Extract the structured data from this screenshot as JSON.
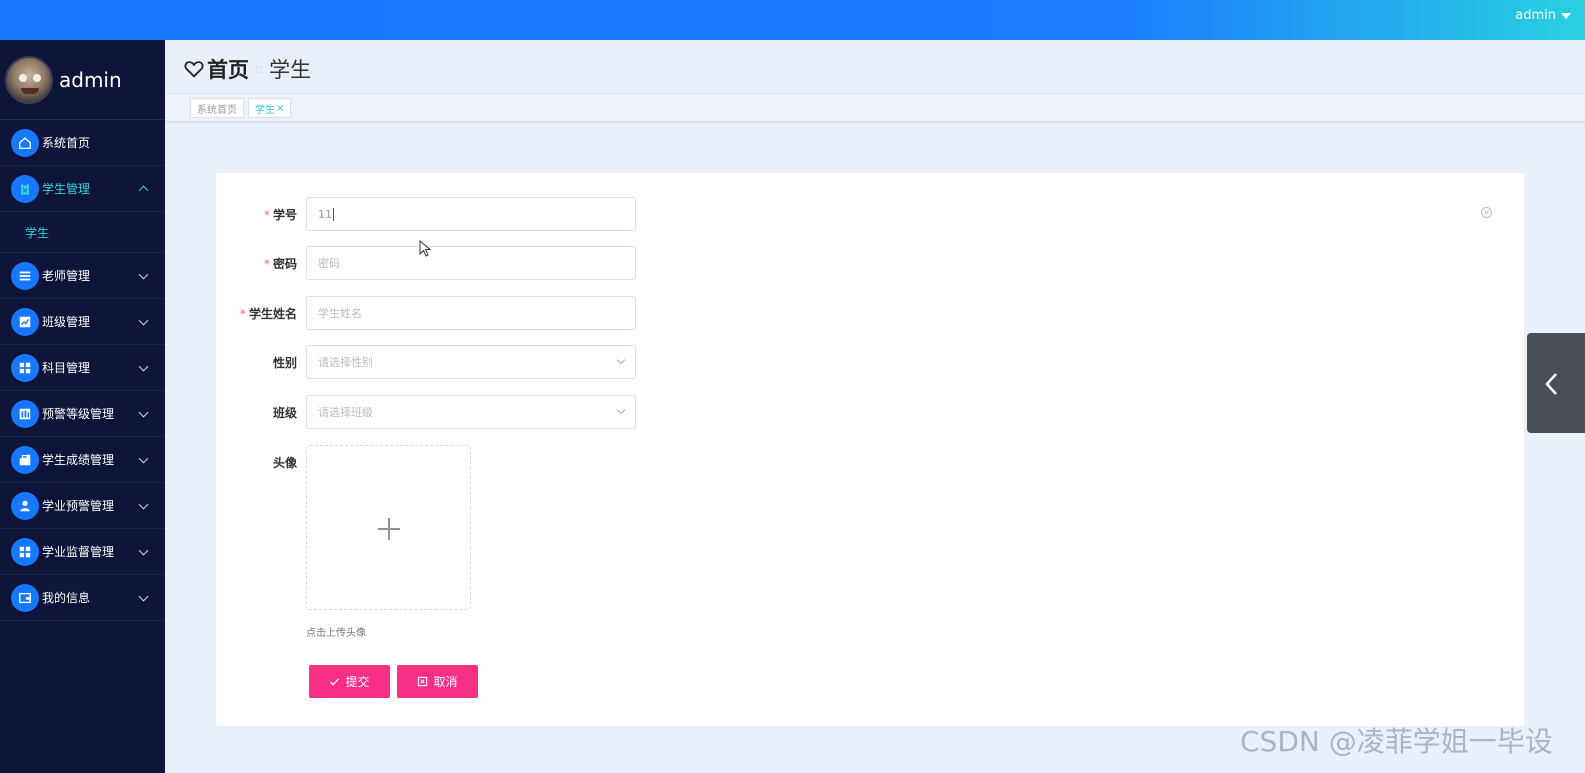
{
  "topbar": {
    "user": "admin"
  },
  "sidebar": {
    "profile_name": "admin",
    "items": [
      {
        "label": "系统首页",
        "icon": "home-icon"
      },
      {
        "label": "学生管理",
        "icon": "clipboard-icon",
        "active": true,
        "expanded": true,
        "children": [
          {
            "label": "学生"
          }
        ]
      },
      {
        "label": "老师管理",
        "icon": "list-icon"
      },
      {
        "label": "班级管理",
        "icon": "chart-icon"
      },
      {
        "label": "科目管理",
        "icon": "grid-icon"
      },
      {
        "label": "预警等级管理",
        "icon": "bars-icon"
      },
      {
        "label": "学生成绩管理",
        "icon": "briefcase-icon"
      },
      {
        "label": "学业预警管理",
        "icon": "user-icon"
      },
      {
        "label": "学业监督管理",
        "icon": "grid-icon"
      },
      {
        "label": "我的信息",
        "icon": "wallet-icon"
      }
    ]
  },
  "header": {
    "home": "首页",
    "separator": "::",
    "current": "学生"
  },
  "tabs": [
    {
      "label": "系统首页"
    },
    {
      "label": "学生",
      "close": "×"
    }
  ],
  "form": {
    "fields": [
      {
        "label": "学号",
        "required": true,
        "value": "11",
        "placeholder": ""
      },
      {
        "label": "密码",
        "required": true,
        "value": "",
        "placeholder": "密码"
      },
      {
        "label": "学生姓名",
        "required": true,
        "value": "",
        "placeholder": "学生姓名"
      },
      {
        "label": "性别",
        "required": false,
        "value": "",
        "placeholder": "请选择性别"
      },
      {
        "label": "班级",
        "required": false,
        "value": "",
        "placeholder": "请选择班级"
      }
    ],
    "avatar_label": "头像",
    "upload_tip": "点击上传头像",
    "submit_label": "提交",
    "cancel_label": "取消",
    "required_mark": "*"
  },
  "watermark": "CSDN @凌菲学姐一毕设",
  "colors": {
    "accent": "#1677ff",
    "teal": "#35d3d8",
    "button": "#f72f85",
    "sidebar": "#0f1539"
  }
}
